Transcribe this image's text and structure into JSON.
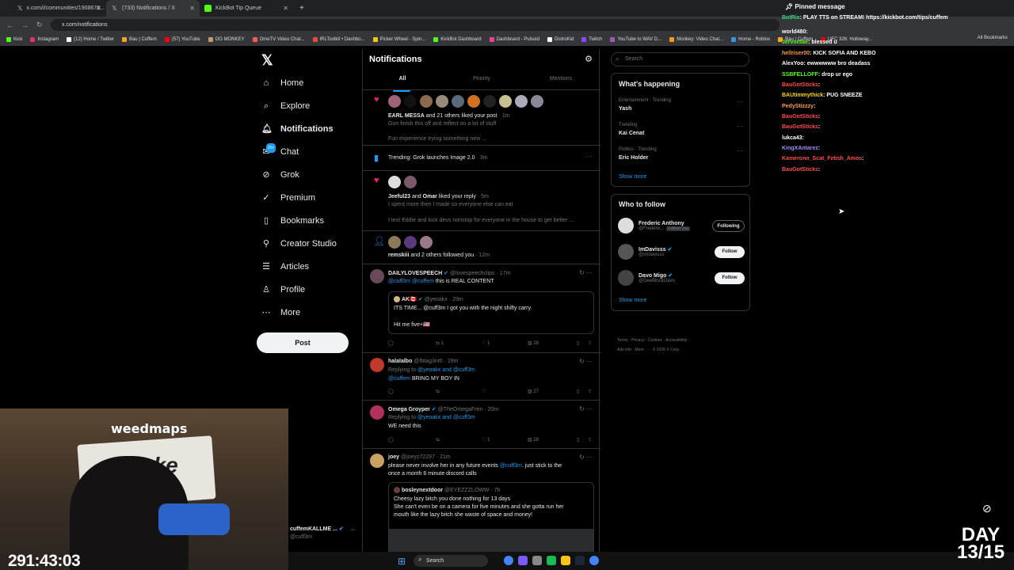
{
  "browser": {
    "tabs": [
      {
        "title": "x.com/i/communities/1908678...",
        "active": false
      },
      {
        "title": "(733) Notifications / X",
        "active": true
      },
      {
        "title": "KickBot Tip Queue",
        "active": false
      }
    ],
    "url": "x.com/notifications",
    "bookmarks": [
      "Kick",
      "Instagram",
      "(12) Home / Twitter",
      "Bau | Cuffem",
      "(57) YouTube",
      "OG MONKEY",
      "OmeTV Video Chat...",
      "IRLToolkit • Dashbo...",
      "Picker Wheel - Spin...",
      "KickBot Dashboard",
      "Dashboard - Pulsoid",
      "DistroKid",
      "Twitch",
      "YouTube to WAV D...",
      "Monkey: Video Chat...",
      "Home - Roblox",
      "Bau | Cuffem",
      "UFC 326: Holloway..."
    ],
    "all_bookmarks": "All Bookmarks"
  },
  "nav": {
    "items": [
      "Home",
      "Explore",
      "Notifications",
      "Chat",
      "Grok",
      "Premium",
      "Bookmarks",
      "Creator Studio",
      "Articles",
      "Profile",
      "More"
    ],
    "post_label": "Post",
    "chat_badge": "20+"
  },
  "main": {
    "title": "Notifications",
    "tabs": [
      "All",
      "Priority",
      "Mentions"
    ],
    "n1": {
      "name": "EARL MESSA",
      "text": " and 21 others liked your post",
      "time": " · 1m",
      "preview1": "Gon finish this off and reflect on a lot of stuff",
      "preview2": "Fun experience trying something new ..."
    },
    "n2": {
      "text": "Trending: Grok launches Image 2.0",
      "time": " · 3m"
    },
    "n3": {
      "name1": "Jeeful23",
      "and": " and ",
      "name2": "Omar",
      "text": " liked your reply",
      "time": " · 5m",
      "preview1": "I spent more then I made so everyone else can eat",
      "preview2": "I text Eddie and kick devs nonstop for everyone in the house to get better ..."
    },
    "n4": {
      "name": "remskiii",
      "text": " and 2 others followed you",
      "time": " · 12m"
    },
    "t1": {
      "name": "DAILYLOVESPEECH",
      "handle": "@lovespeechclips · 17m",
      "mention1": "@cuff3m",
      "mention2": "@cuffem",
      "text": " this is REAL CONTENT",
      "quote_name": "AK🇨🇦",
      "quote_handle": "@yeoakx · 29m",
      "quote_text1": "ITS TIME... @cuff3m I got you with the night shifty carry.",
      "quote_text2": "Hit me five+🇺🇸",
      "retweets": "1",
      "likes": "1",
      "views": "28"
    },
    "t2": {
      "name": "halalalbo",
      "handle": "@fbtag3nt0 · 19m",
      "replying": "Replying to ",
      "replying_to": "@yeoakx and @cuff3m",
      "mention": "@cuffem",
      "text": " BRING MY BOY IN",
      "views": "27"
    },
    "t3": {
      "name": "Omega Groyper",
      "handle": "@TheOmegaFren · 20m",
      "replying": "Replying to ",
      "replying_to": "@yeoakx and @cuff3m",
      "text": "WE need this",
      "likes": "1",
      "views": "28"
    },
    "t4": {
      "name": "joey",
      "handle": "@joeyz72297 · 21m",
      "text1": "please never involve her in any future events ",
      "mention": "@cuff3m",
      "text1b": ". just stick to the",
      "text2": "once a month 6 minute discord calls",
      "quote_name": "bosleynextdoor",
      "quote_handle": "@EYEZZZLOWW · 7h",
      "quote_text1": "Cheesy lazy bitch you done nothing for 13  days",
      "quote_text2": "She can't even be on a camera for five minutes and she gotta run her",
      "quote_text3": "mouth like the lazy bitch she waste of space and money!"
    }
  },
  "right": {
    "search_placeholder": "Search",
    "happening_title": "What's happening",
    "trends": [
      {
        "meta": "Entertainment · Trending",
        "name": "Yash"
      },
      {
        "meta": "Trending",
        "name": "Kai Cenat"
      },
      {
        "meta": "Politics · Trending",
        "name": "Eric Holder"
      }
    ],
    "show_more": "Show more",
    "wtf_title": "Who to follow",
    "follows": [
      {
        "name": "Frederic Anthony",
        "handle": "@Frederic...",
        "extra": "Follows you",
        "button": "Following"
      },
      {
        "name": "ImDavisss",
        "handle": "@imdavisss",
        "extra": "",
        "button": "Follow"
      },
      {
        "name": "Davo Migo",
        "handle": "@DeeBlockDavo",
        "extra": "",
        "button": "Follow"
      }
    ],
    "footer1": "Terms   ·   Privacy   ·   Cookies   ·   Accessibility",
    "footer2": "Ads info   ·   More ···   ·   © 2026 X Corp."
  },
  "chat": {
    "pinned": "Pinned message",
    "lines": [
      {
        "user": "BotRix",
        "msg": "PLAY TTS on STREAM! https://kickbot.com/tips/cuffem",
        "color": "#3ddc84"
      },
      {
        "user": "world480",
        "msg": "",
        "color": "#ffffff"
      },
      {
        "user": "Jervontae",
        "msg": "blessed u",
        "color": "#53fc18"
      },
      {
        "user": "hellriser00",
        "msg": "KICK SOFIA AND KEBO",
        "color": "#ff9f43"
      },
      {
        "user": "AlexYoo",
        "msg": "ewwwwww bro deadass",
        "color": "#ffffff"
      },
      {
        "user": "SSBFELLOFF",
        "msg": "drop ur ego",
        "color": "#53fc18"
      },
      {
        "user": "BauGotSticks",
        "msg": "",
        "color": "#ff4d4d"
      },
      {
        "user": "BAUtimmythick",
        "msg": "PUG SNEEZE",
        "color": "#ffd700"
      },
      {
        "user": "PedyStizzzy",
        "msg": "",
        "color": "#ff9f43"
      },
      {
        "user": "BauGotSticks",
        "msg": "",
        "color": "#ff4d4d"
      },
      {
        "user": "BauGotSticks",
        "msg": "",
        "color": "#ff4d4d"
      },
      {
        "user": "lukca43",
        "msg": "",
        "color": "#ffffff"
      },
      {
        "user": "KingXAntarez",
        "msg": "",
        "color": "#a78bfa"
      },
      {
        "user": "Kameronn_Scat_Fetish_Amos",
        "msg": "",
        "color": "#ff4d4d"
      },
      {
        "user": "BauGotSticks",
        "msg": "",
        "color": "#ff4d4d"
      }
    ]
  },
  "stream": {
    "timer": "291:43:03",
    "day1": "DAY",
    "day2": "13/15",
    "cam_text1": "weedmaps",
    "cam_text2": "Stake",
    "profile_name": "cuffemKALLME ...",
    "profile_handle": "@cuff3m"
  },
  "taskbar": {
    "search": "Search"
  }
}
